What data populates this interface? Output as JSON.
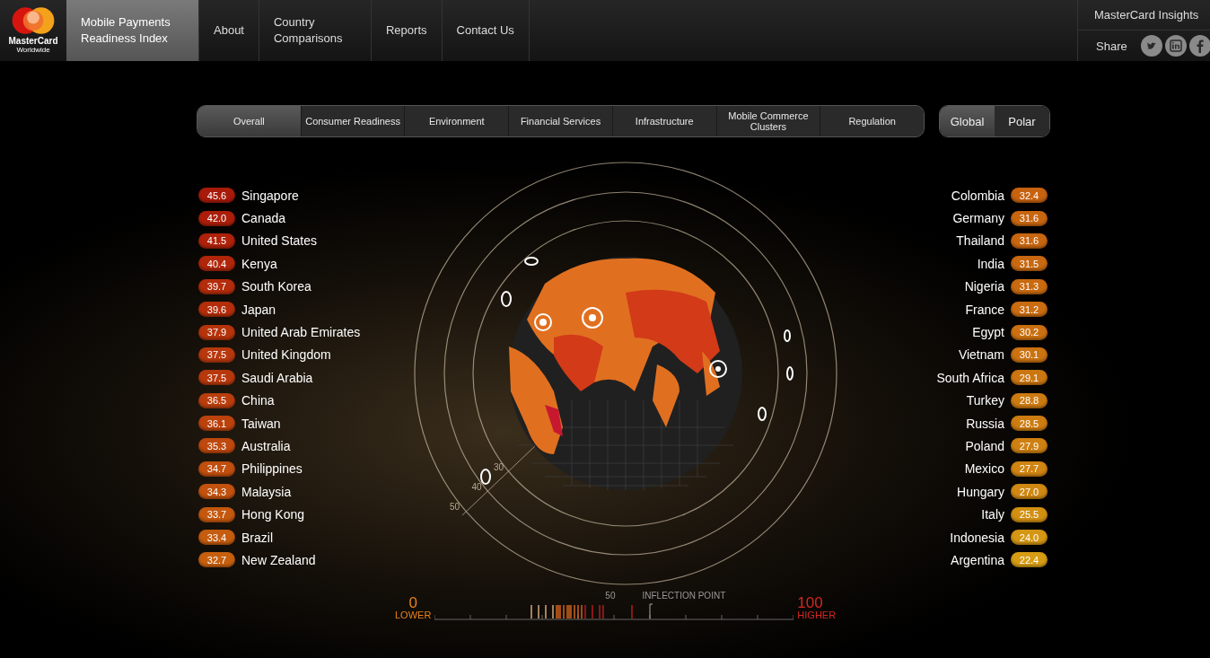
{
  "header": {
    "logo": {
      "name": "MasterCard",
      "sub": "Worldwide"
    },
    "nav": [
      {
        "label": "Mobile Payments Readiness Index",
        "selected": true
      },
      {
        "label": "About",
        "selected": false
      },
      {
        "label": "Country Comparisons",
        "selected": false
      },
      {
        "label": "Reports",
        "selected": false
      },
      {
        "label": "Contact Us",
        "selected": false
      }
    ],
    "insights": "MasterCard Insights",
    "share": "Share"
  },
  "categories": [
    {
      "label": "Overall",
      "selected": true
    },
    {
      "label": "Consumer Readiness",
      "selected": false
    },
    {
      "label": "Environment",
      "selected": false
    },
    {
      "label": "Financial Services",
      "selected": false
    },
    {
      "label": "Infrastructure",
      "selected": false
    },
    {
      "label": "Mobile Commerce Clusters",
      "selected": false
    },
    {
      "label": "Regulation",
      "selected": false
    }
  ],
  "views": [
    {
      "label": "Global",
      "selected": true
    },
    {
      "label": "Polar",
      "selected": false
    }
  ],
  "left_ranking": [
    {
      "score": "45.6",
      "country": "Singapore",
      "color": "#a81a0a"
    },
    {
      "score": "42.0",
      "country": "Canada",
      "color": "#ac1e0a"
    },
    {
      "score": "41.5",
      "country": "United States",
      "color": "#ae220b"
    },
    {
      "score": "40.4",
      "country": "Kenya",
      "color": "#b0260b"
    },
    {
      "score": "39.7",
      "country": "South Korea",
      "color": "#b32c0c"
    },
    {
      "score": "39.6",
      "country": "Japan",
      "color": "#b42e0c"
    },
    {
      "score": "37.9",
      "country": "United Arab Emirates",
      "color": "#b6340c"
    },
    {
      "score": "37.5",
      "country": "United Kingdom",
      "color": "#b8380d"
    },
    {
      "score": "37.5",
      "country": "Saudi Arabia",
      "color": "#b8380d"
    },
    {
      "score": "36.5",
      "country": "China",
      "color": "#ba3e0d"
    },
    {
      "score": "36.1",
      "country": "Taiwan",
      "color": "#bc420d"
    },
    {
      "score": "35.3",
      "country": "Australia",
      "color": "#be480e"
    },
    {
      "score": "34.7",
      "country": "Philippines",
      "color": "#c04e0e"
    },
    {
      "score": "34.3",
      "country": "Malaysia",
      "color": "#c2520e"
    },
    {
      "score": "33.7",
      "country": "Hong Kong",
      "color": "#c4580f"
    },
    {
      "score": "33.4",
      "country": "Brazil",
      "color": "#c55c0f"
    },
    {
      "score": "32.7",
      "country": "New Zealand",
      "color": "#c6600f"
    }
  ],
  "right_ranking": [
    {
      "score": "32.4",
      "country": "Colombia",
      "color": "#c66210"
    },
    {
      "score": "31.6",
      "country": "Germany",
      "color": "#c86610"
    },
    {
      "score": "31.6",
      "country": "Thailand",
      "color": "#c86610"
    },
    {
      "score": "31.5",
      "country": "India",
      "color": "#c86810"
    },
    {
      "score": "31.3",
      "country": "Nigeria",
      "color": "#c96a10"
    },
    {
      "score": "31.2",
      "country": "France",
      "color": "#ca6c10"
    },
    {
      "score": "30.2",
      "country": "Egypt",
      "color": "#cb7010"
    },
    {
      "score": "30.1",
      "country": "Vietnam",
      "color": "#cb7211"
    },
    {
      "score": "29.1",
      "country": "South Africa",
      "color": "#cc7611"
    },
    {
      "score": "28.8",
      "country": "Turkey",
      "color": "#cd7a11"
    },
    {
      "score": "28.5",
      "country": "Russia",
      "color": "#ce7c11"
    },
    {
      "score": "27.9",
      "country": "Poland",
      "color": "#cf8012"
    },
    {
      "score": "27.7",
      "country": "Mexico",
      "color": "#d08412"
    },
    {
      "score": "27.0",
      "country": "Hungary",
      "color": "#d08812"
    },
    {
      "score": "25.5",
      "country": "Italy",
      "color": "#d29012"
    },
    {
      "score": "24.0",
      "country": "Indonesia",
      "color": "#d49613"
    },
    {
      "score": "22.4",
      "country": "Argentina",
      "color": "#d69c14"
    }
  ],
  "globe": {
    "ring_labels": [
      "30",
      "40",
      "50"
    ]
  },
  "scale": {
    "min": "0",
    "min_label": "LOWER",
    "mid": "50",
    "inflection": "INFLECTION POINT",
    "max": "100",
    "max_label": "HIGHER"
  }
}
